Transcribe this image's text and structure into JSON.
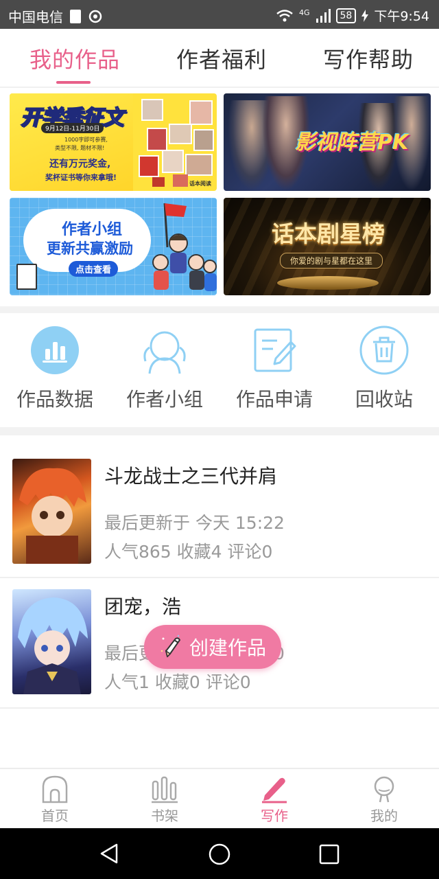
{
  "status_bar": {
    "carrier": "中国电信",
    "network": "4G",
    "battery": "58",
    "time": "下午9:54"
  },
  "tabs": [
    {
      "label": "我的作品",
      "active": true
    },
    {
      "label": "作者福利",
      "active": false
    },
    {
      "label": "写作帮助",
      "active": false
    }
  ],
  "banners": {
    "b1": {
      "title": "开学季征文",
      "dates": "9月12日-11月30日",
      "line1": "1000字即可参赛,",
      "line2": "类型不限, 题材不限!",
      "line3": "还有万元奖金,",
      "line4": "奖杯证书等你来拿哦!",
      "logo": "话本阅读"
    },
    "b2": {
      "title": "影视阵营PK"
    },
    "b3": {
      "title1": "作者小组",
      "title2": "更新共赢激励",
      "button": "点击查看"
    },
    "b4": {
      "title": "话本剧星榜",
      "subtitle": "你爱的剧与星都在这里"
    }
  },
  "entries": [
    {
      "label": "作品数据",
      "icon": "chart-icon"
    },
    {
      "label": "作者小组",
      "icon": "group-icon"
    },
    {
      "label": "作品申请",
      "icon": "apply-icon"
    },
    {
      "label": "回收站",
      "icon": "trash-icon"
    }
  ],
  "works": [
    {
      "title": "斗龙战士之三代并肩",
      "updated": "最后更新于 今天 15:22",
      "stats": "人气865 收藏4 评论0"
    },
    {
      "title": "团宠，浩",
      "updated": "最后更新于 今天 15:20",
      "stats": "人气1 收藏0 评论0"
    }
  ],
  "fab": {
    "label": "创建作品"
  },
  "bottom_nav": [
    {
      "label": "首页",
      "icon": "home-icon",
      "active": false
    },
    {
      "label": "书架",
      "icon": "bookshelf-icon",
      "active": false
    },
    {
      "label": "写作",
      "icon": "pen-icon",
      "active": true
    },
    {
      "label": "我的",
      "icon": "profile-icon",
      "active": false
    }
  ],
  "colors": {
    "accent": "#e8608a",
    "fab": "#f07aa3",
    "icon_blue": "#7ec8ef"
  }
}
